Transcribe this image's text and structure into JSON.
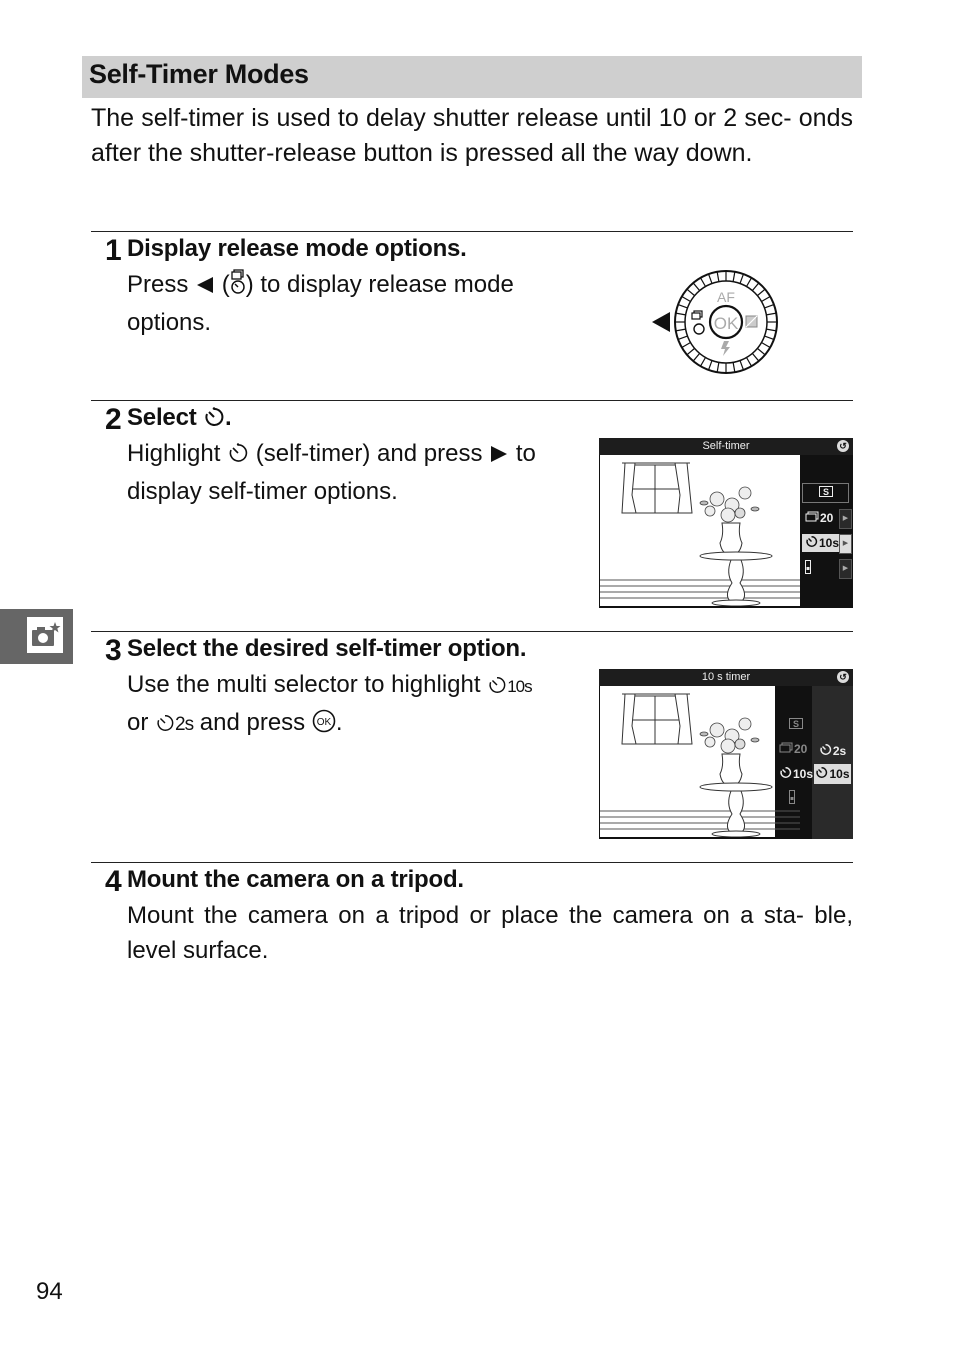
{
  "section": {
    "title": "Self-Timer Modes",
    "intro": "The self-timer is used to delay shutter release until 10 or 2 sec- onds after the shutter-release button is pressed all the way down."
  },
  "steps": [
    {
      "number": "1",
      "title": "Display release mode options.",
      "body_parts": [
        "Press",
        "(",
        ") to display release mode options."
      ]
    },
    {
      "number": "2",
      "title_prefix": "Select",
      "title_suffix": ".",
      "body_parts": [
        "Highlight",
        "(self-timer) and press",
        "to display self-timer options."
      ]
    },
    {
      "number": "3",
      "title": "Select the desired self-timer option.",
      "body_parts": [
        "Use the multi selector to highlight",
        "10s",
        "or",
        "2s",
        "and press",
        "."
      ]
    },
    {
      "number": "4",
      "title": "Mount the camera on a tripod.",
      "body": "Mount the camera on a tripod or place the camera on a sta- ble, level surface."
    }
  ],
  "dial": {
    "top_label": "AF",
    "center_label": "OK"
  },
  "screen1": {
    "title": "Self-timer",
    "items": [
      {
        "icon": "single-frame-icon",
        "label": "S",
        "selected": false,
        "has_arrow": false
      },
      {
        "icon": "continuous-icon",
        "label": "20",
        "selected": false,
        "has_arrow": true
      },
      {
        "icon": "self-timer-icon",
        "label": "10s",
        "selected": true,
        "has_arrow": true
      },
      {
        "icon": "remote-icon",
        "label": "",
        "selected": false,
        "has_arrow": true
      }
    ]
  },
  "screen2": {
    "title": "10 s timer",
    "left_items": [
      {
        "icon": "single-frame-icon",
        "label": "S"
      },
      {
        "icon": "continuous-icon",
        "label": "20"
      },
      {
        "icon": "self-timer-icon",
        "label": "10s"
      },
      {
        "icon": "remote-icon",
        "label": ""
      }
    ],
    "right_items": [
      {
        "icon": "self-timer-icon",
        "label": "2s",
        "selected": false
      },
      {
        "icon": "self-timer-icon",
        "label": "10s",
        "selected": true
      }
    ]
  },
  "sidebar": {
    "icon": "camera-star-icon"
  },
  "page_number": "94"
}
